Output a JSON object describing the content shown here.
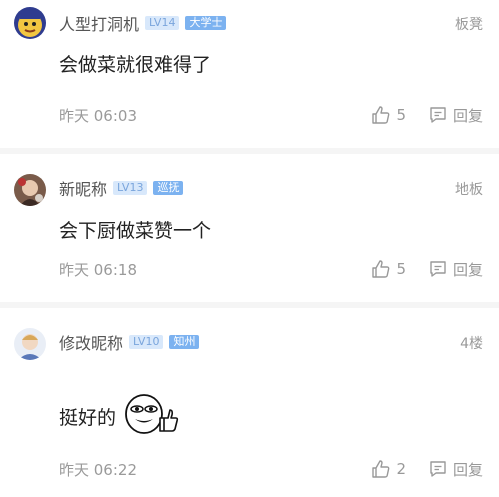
{
  "comments": [
    {
      "username": "人型打洞机",
      "level": "LV14",
      "tag": "大学士",
      "floor": "板凳",
      "text": "会做菜就很难得了",
      "time": "昨天 06:03",
      "likes": "5",
      "reply_label": "回复"
    },
    {
      "username": "新昵称",
      "level": "LV13",
      "tag": "巡抚",
      "floor": "地板",
      "text": "会下厨做菜赞一个",
      "time": "昨天 06:18",
      "likes": "5",
      "reply_label": "回复"
    },
    {
      "username": "修改昵称",
      "level": "LV10",
      "tag": "知州",
      "floor": "4楼",
      "text": "挺好的",
      "emoji": "thumbs-up-emoji",
      "time": "昨天 06:22",
      "likes": "2",
      "reply_label": "回复"
    }
  ],
  "colors": {
    "level_badge_bg": "#d8e8fb",
    "tag_badge_bg": "#7cb2f0",
    "meta_text": "#9a9a9a"
  }
}
